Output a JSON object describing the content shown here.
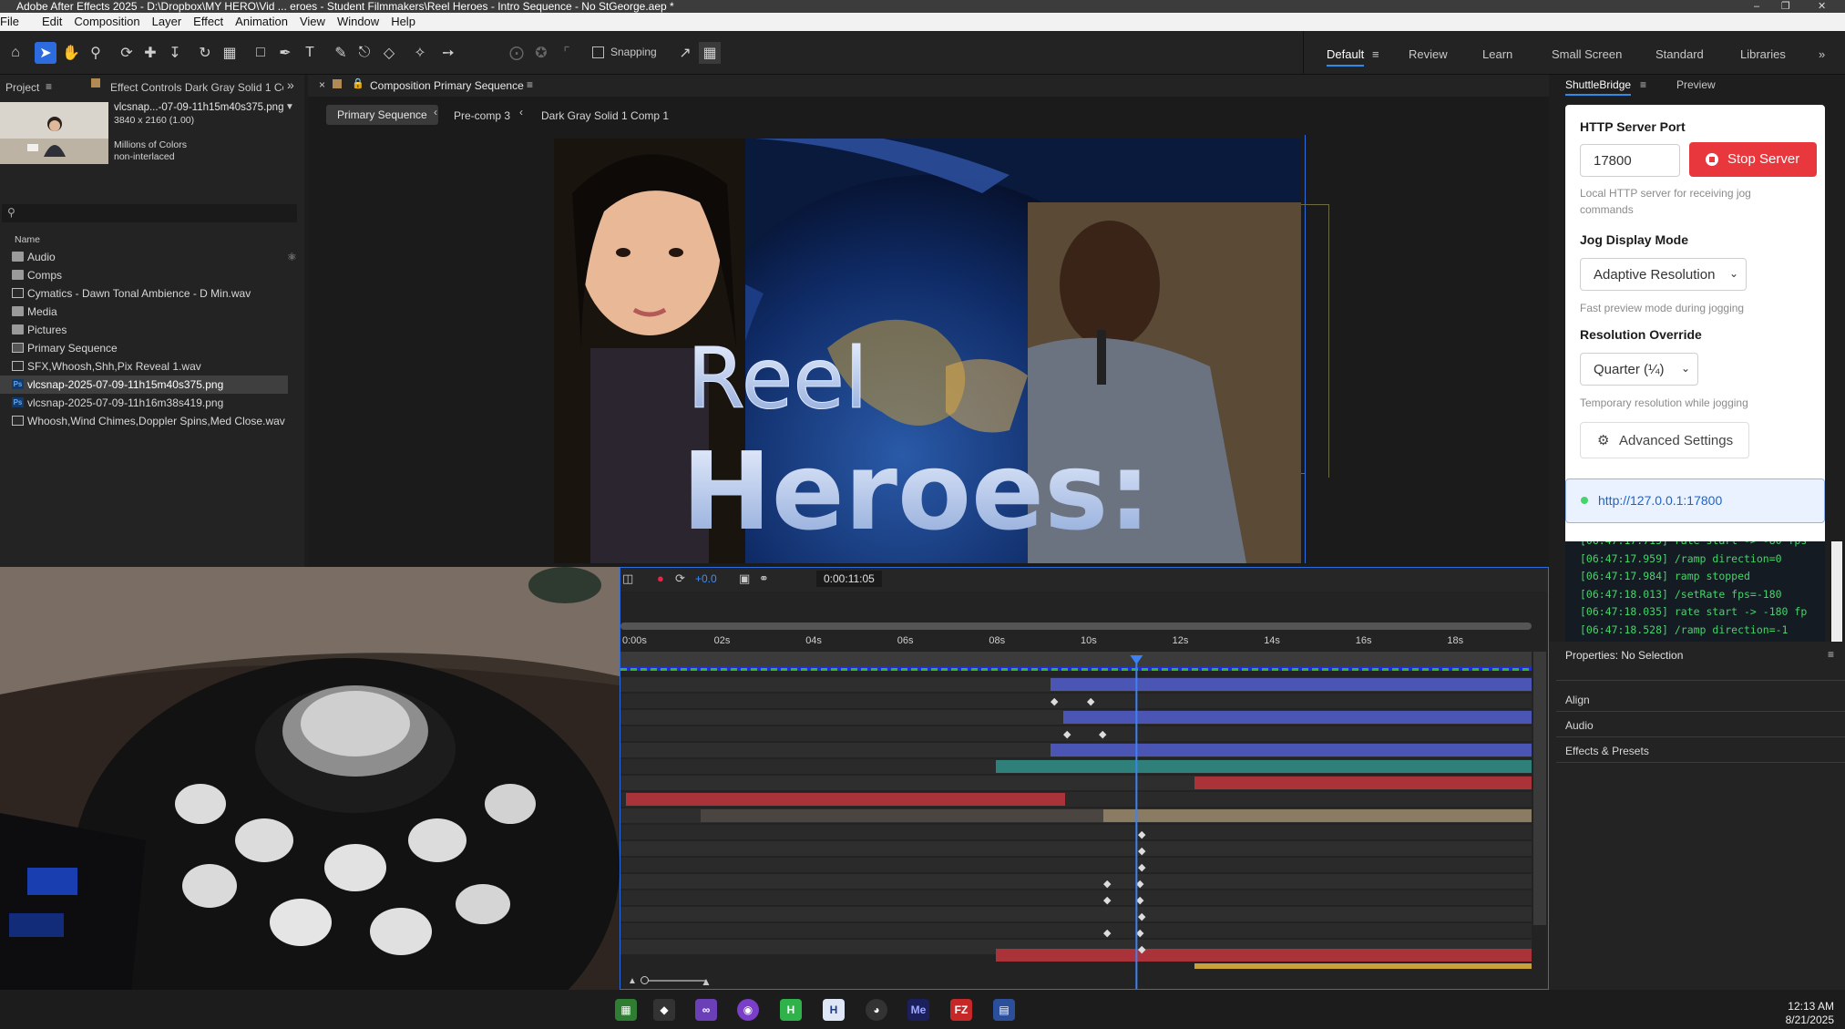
{
  "window": {
    "title": "Adobe After Effects 2025 - D:\\Dropbox\\MY HERO\\Vid ... eroes - Student Filmmakers\\Reel Heroes - Intro Sequence - No StGeorge.aep *"
  },
  "menu": [
    "File",
    "Edit",
    "Composition",
    "Layer",
    "Effect",
    "Animation",
    "View",
    "Window",
    "Help"
  ],
  "toolbar": {
    "snapping_label": "Snapping",
    "workspaces": [
      "Default",
      "Review",
      "Learn",
      "Small Screen",
      "Standard",
      "Libraries"
    ],
    "active_workspace": "Default",
    "more": "»"
  },
  "project": {
    "tab_project": "Project",
    "tab_effect_controls": "Effect Controls Dark Gray Solid 1 Cor",
    "more": "»",
    "preview_name": "vlcsnap...-07-09-11h15m40s375.png",
    "preview_dims": "3840 x 2160 (1.00)",
    "preview_colors": "Millions of Colors",
    "preview_interlace": "non-interlaced",
    "search_placeholder": "",
    "column_name": "Name",
    "items": [
      {
        "name": "Audio",
        "type": "folder"
      },
      {
        "name": "Comps",
        "type": "folder"
      },
      {
        "name": "Cymatics - Dawn Tonal Ambience - D Min.wav",
        "type": "file"
      },
      {
        "name": "Media",
        "type": "folder"
      },
      {
        "name": "Pictures",
        "type": "folder"
      },
      {
        "name": "Primary Sequence",
        "type": "comp"
      },
      {
        "name": "SFX,Whoosh,Shh,Pix Reveal 1.wav",
        "type": "file"
      },
      {
        "name": "vlcsnap-2025-07-09-11h15m40s375.png",
        "type": "psd",
        "selected": true
      },
      {
        "name": "vlcsnap-2025-07-09-11h16m38s419.png",
        "type": "psd"
      },
      {
        "name": "Whoosh,Wind Chimes,Doppler Spins,Med Close.wav",
        "type": "file"
      }
    ]
  },
  "composition": {
    "panel_title": "Composition Primary Sequence",
    "breadcrumbs": [
      "Primary Sequence",
      "Pre-comp 3",
      "Dark Gray Solid 1 Comp 1"
    ],
    "title_line1": "Reel",
    "title_line2": "Heroes:"
  },
  "timeline": {
    "exposure": "+0.0",
    "timecode": "0:00:11:05",
    "ticks": [
      "0:00s",
      "02s",
      "04s",
      "06s",
      "08s",
      "10s",
      "12s",
      "14s",
      "16s",
      "18s"
    ],
    "playhead_seconds": 11.2
  },
  "shuttle": {
    "tab": "ShuttleBridge",
    "tab_preview": "Preview",
    "http_label": "HTTP Server Port",
    "port": "17800",
    "stop_button": "Stop Server",
    "http_hint": "Local HTTP server for receiving jog commands",
    "jog_label": "Jog Display Mode",
    "jog_value": "Adaptive Resolution",
    "jog_hint": "Fast preview mode during jogging",
    "res_label": "Resolution Override",
    "res_value": "Quarter (¼)",
    "res_hint": "Temporary resolution while jogging",
    "advanced": "Advanced Settings",
    "url": "http://127.0.0.1:17800",
    "log": [
      "[06:47:17.715] rate start -> -80 fps",
      "[06:47:17.959] /ramp direction=0",
      "[06:47:17.984] ramp stopped",
      "[06:47:18.013] /setRate fps=-180",
      "[06:47:18.035] rate start -> -180 fp",
      "[06:47:18.528] /ramp direction=-1"
    ]
  },
  "properties": {
    "title": "Properties: No Selection",
    "sections": [
      "Align",
      "Audio",
      "Effects & Presets"
    ]
  },
  "taskbar": {
    "time": "12:13 AM",
    "date": "8/21/2025"
  },
  "colors": {
    "accent": "#2d6cdf",
    "stop_red": "#e8383d",
    "log_green": "#46d36a"
  }
}
